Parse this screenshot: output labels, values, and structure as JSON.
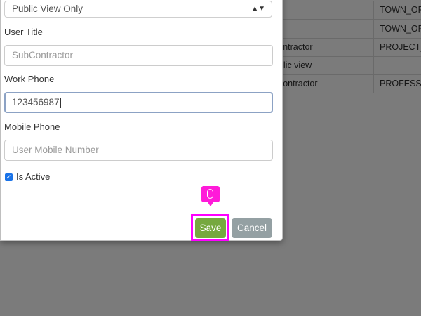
{
  "background_table": {
    "rows": [
      {
        "col1": "",
        "col2": "TOWN_OF"
      },
      {
        "col1": "",
        "col2": "TOWN_OF"
      },
      {
        "col1": "contractor",
        "col2": "PROJECT_"
      },
      {
        "col1": "ublic view",
        "col2": ""
      },
      {
        "col1": "bcontractor",
        "col2": "PROFESSIO"
      }
    ]
  },
  "form": {
    "select_value": "Public View Only",
    "user_title_label": "User Title",
    "user_title_value": "SubContractor",
    "work_phone_label": "Work Phone",
    "work_phone_value": "123456987",
    "mobile_phone_label": "Mobile Phone",
    "mobile_phone_placeholder": "User Mobile Number",
    "is_active_label": "Is Active",
    "is_active_checked": true
  },
  "buttons": {
    "save": "Save",
    "cancel": "Cancel"
  },
  "colors": {
    "save": "#76a83f",
    "cancel": "#94a0a3",
    "highlight": "#ff00ff"
  }
}
